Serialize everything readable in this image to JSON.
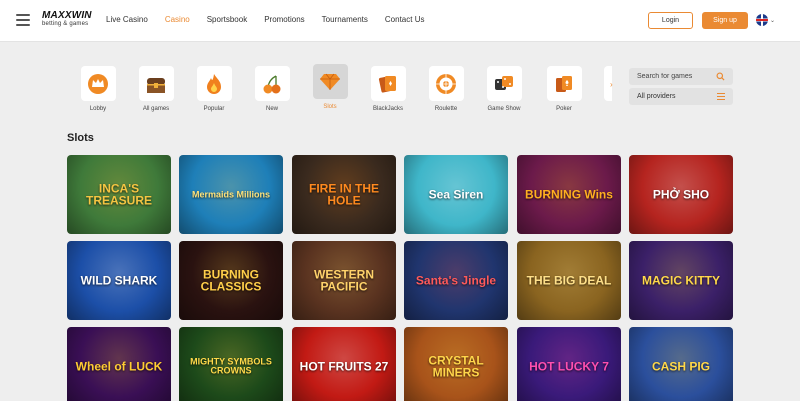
{
  "header": {
    "logo_main": "MAXXWIN",
    "logo_sub": "betting & games",
    "nav": [
      "Live Casino",
      "Casino",
      "Sportsbook",
      "Promotions",
      "Tournaments",
      "Contact Us"
    ],
    "active_nav": "Casino",
    "login_label": "Login",
    "signup_label": "Sign up",
    "language_icon": "uk-flag-icon"
  },
  "categories": [
    {
      "label": "Lobby",
      "icon": "crown-icon"
    },
    {
      "label": "All games",
      "icon": "chest-icon"
    },
    {
      "label": "Popular",
      "icon": "fire-icon"
    },
    {
      "label": "New",
      "icon": "cherries-icon"
    },
    {
      "label": "Slots",
      "icon": "diamond-icon",
      "active": true
    },
    {
      "label": "BlackJacks",
      "icon": "cards-icon"
    },
    {
      "label": "Roulette",
      "icon": "roulette-icon"
    },
    {
      "label": "Game Show",
      "icon": "dice-icon"
    },
    {
      "label": "Poker",
      "icon": "poker-cards-icon"
    }
  ],
  "search": {
    "placeholder": "Search for games"
  },
  "providers": {
    "label": "All providers"
  },
  "section_title": "Slots",
  "games": [
    {
      "title": "INCA'S TREASURE",
      "bg": "#3f7a3a",
      "accent": "#f5c542"
    },
    {
      "title": "Mermaids Millions",
      "bg": "#1e7fb8",
      "accent": "#ffe27a"
    },
    {
      "title": "FIRE IN THE HOLE",
      "bg": "#3a2a1e",
      "accent": "#ff8a1f"
    },
    {
      "title": "Sea Siren",
      "bg": "#3fb6c9",
      "accent": "#ffffff"
    },
    {
      "title": "BURNING Wins",
      "bg": "#6b1a4a",
      "accent": "#ffb020"
    },
    {
      "title": "PHỞ SHO",
      "bg": "#b5241f",
      "accent": "#ffffff"
    },
    {
      "title": "WILD SHARK",
      "bg": "#1c4fa8",
      "accent": "#ffffff"
    },
    {
      "title": "BURNING CLASSICS",
      "bg": "#2a1210",
      "accent": "#ffcf4a"
    },
    {
      "title": "WESTERN PACIFIC",
      "bg": "#5a3320",
      "accent": "#ffd36b"
    },
    {
      "title": "Santa's Jingle",
      "bg": "#20356e",
      "accent": "#ff5a5a"
    },
    {
      "title": "THE BIG DEAL",
      "bg": "#8a6420",
      "accent": "#ffe08a"
    },
    {
      "title": "MAGIC KITTY",
      "bg": "#3b2068",
      "accent": "#ffd84a"
    },
    {
      "title": "Wheel of LUCK",
      "bg": "#3a0f55",
      "accent": "#ffcc33"
    },
    {
      "title": "MIGHTY SYMBOLS CROWNS",
      "bg": "#1d4a1a",
      "accent": "#ffd94a"
    },
    {
      "title": "HOT FRUITS 27",
      "bg": "#c21a14",
      "accent": "#ffffff"
    },
    {
      "title": "CRYSTAL MINERS",
      "bg": "#a8531a",
      "accent": "#ffd64a"
    },
    {
      "title": "HOT LUCKY 7",
      "bg": "#3a1a7a",
      "accent": "#ff4fb0"
    },
    {
      "title": "CASH PIG",
      "bg": "#2b4f9c",
      "accent": "#ffd84a"
    }
  ]
}
